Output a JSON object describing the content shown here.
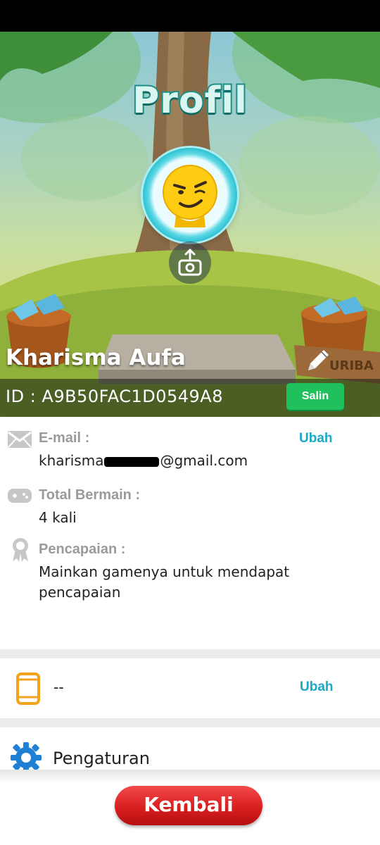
{
  "screen": {
    "title": "Profil",
    "user_name": "Kharisma Aufa",
    "user_id": "ID : A9B50FAC1D0549A8",
    "copy_label": "Salin",
    "sign_text": "URIBA"
  },
  "info": {
    "email_label": "E-mail :",
    "email_prefix": "kharisma",
    "email_suffix": "@gmail.com",
    "email_change": "Ubah",
    "plays_label": "Total Bermain :",
    "plays_value": "4 kali",
    "achievement_label": "Pencapaian :",
    "achievement_value": "Mainkan gamenya untuk mendapat pencapaian"
  },
  "phone": {
    "value": "--",
    "change": "Ubah"
  },
  "settings": {
    "label": "Pengaturan"
  },
  "footer": {
    "back_label": "Kembali"
  },
  "colors": {
    "accent_teal": "#1aa9c6",
    "copy_green": "#20c05c",
    "back_red": "#d91e1e",
    "phone_orange": "#f3a21c",
    "settings_blue": "#1f7fd4"
  },
  "icons": [
    "envelope-icon",
    "gamepad-icon",
    "award-icon",
    "phone-icon",
    "gear-icon",
    "camera-upload-icon",
    "pencil-icon"
  ]
}
